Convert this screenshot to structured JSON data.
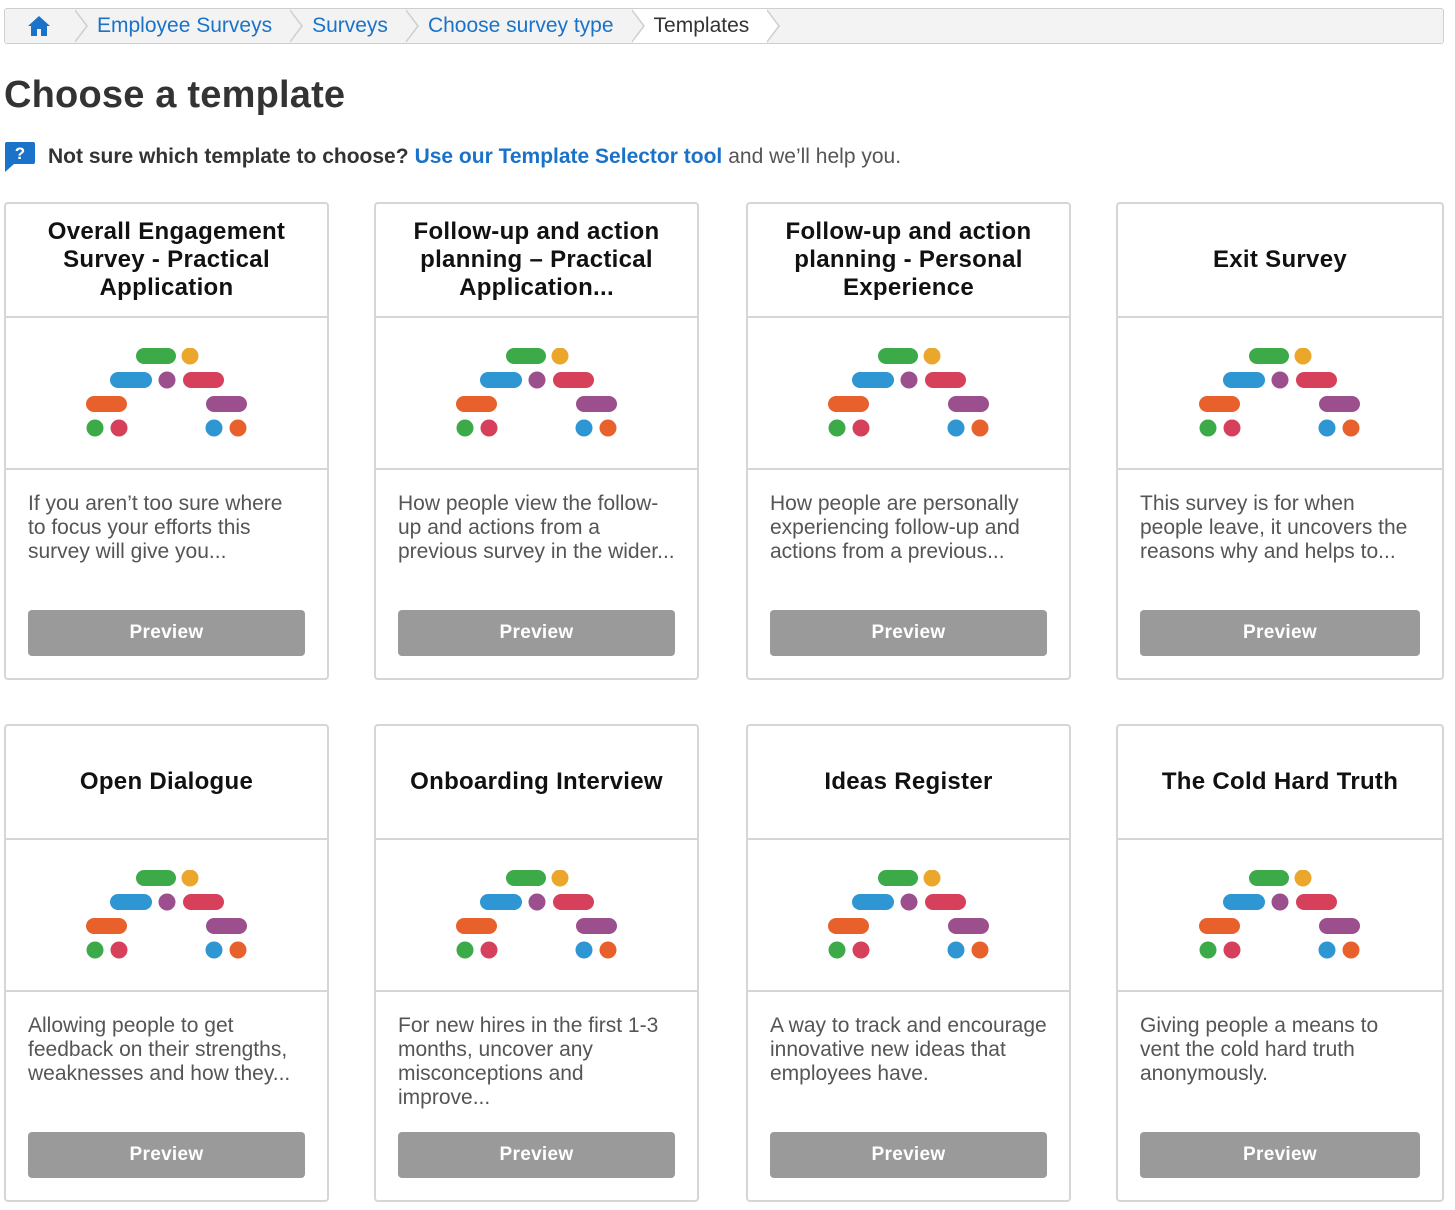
{
  "breadcrumb": {
    "home_icon": "home-icon",
    "items": [
      {
        "label": "Employee Surveys",
        "link": true
      },
      {
        "label": "Surveys",
        "link": true
      },
      {
        "label": "Choose survey type",
        "link": true
      },
      {
        "label": "Templates",
        "link": false
      }
    ]
  },
  "page": {
    "title": "Choose a template"
  },
  "help": {
    "icon": "question-icon",
    "prefix": "Not sure which template to choose?",
    "link_text": "Use our Template Selector tool",
    "suffix": "and we’ll help you."
  },
  "colors": {
    "link": "#1a73c8",
    "button": "#9a9a9a",
    "logo_green": "#3daa4a",
    "logo_yellow": "#eaa72c",
    "logo_blue": "#2d96d3",
    "logo_purple": "#9b4f8d",
    "logo_red": "#d6405a",
    "logo_orange": "#e8612c"
  },
  "templates": [
    {
      "title": "Overall Engagement Survey - Practical Application",
      "description": "If you aren’t too sure where to focus your efforts this survey will give you...",
      "button": "Preview"
    },
    {
      "title": "Follow-up and action planning – Practical Application...",
      "description": "How people view the follow-up and actions from a previous survey in the wider...",
      "button": "Preview"
    },
    {
      "title": "Follow-up and action planning - Personal Experience",
      "description": "How people are personally experiencing follow-up and actions from a previous...",
      "button": "Preview"
    },
    {
      "title": "Exit Survey",
      "description": "This survey is for when people leave, it uncovers the reasons why and helps to...",
      "button": "Preview"
    },
    {
      "title": "Open Dialogue",
      "description": "Allowing people to get feedback on their strengths, weaknesses and how they...",
      "button": "Preview"
    },
    {
      "title": "Onboarding Interview",
      "description": "For new hires in the first 1-3 months, uncover any misconceptions and improve...",
      "button": "Preview"
    },
    {
      "title": "Ideas Register",
      "description": "A way to track and encourage innovative new ideas that employees have.",
      "button": "Preview"
    },
    {
      "title": "The Cold Hard Truth",
      "description": "Giving people a means to vent the cold hard truth anonymously.",
      "button": "Preview"
    }
  ]
}
